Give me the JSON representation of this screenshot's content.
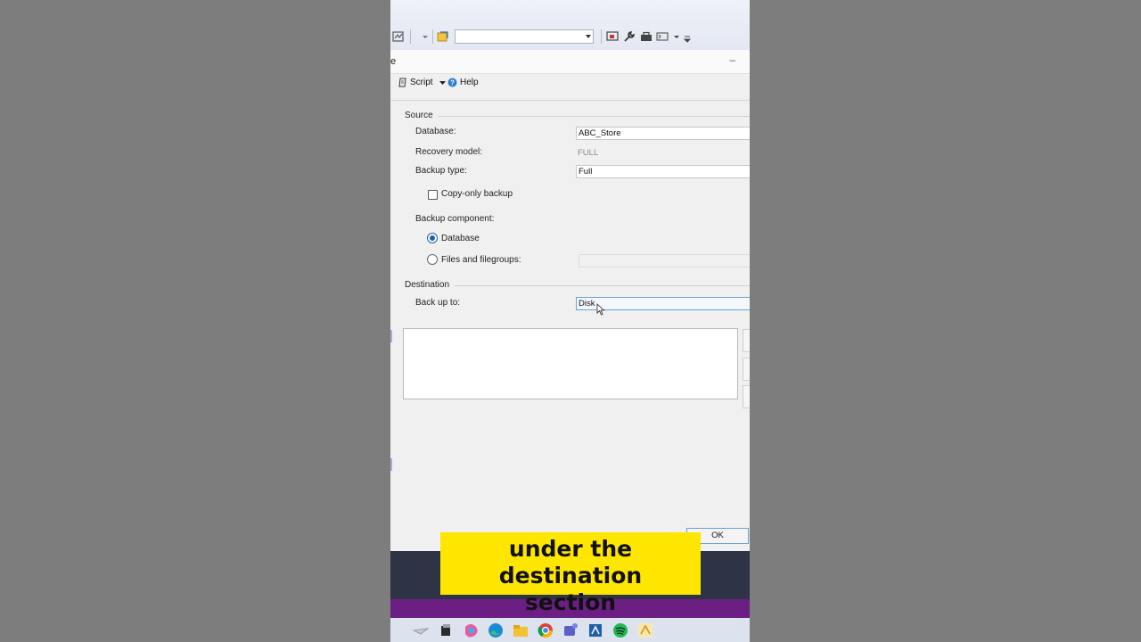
{
  "toolbar": {
    "combo_value": ""
  },
  "dialog": {
    "title_fragment": "e",
    "minimize_glyph": "–",
    "commands": {
      "script_label": "Script",
      "help_label": "Help"
    },
    "source": {
      "section_label": "Source",
      "database_label": "Database:",
      "database_value": "ABC_Store",
      "recovery_label": "Recovery model:",
      "recovery_value": "FULL",
      "backup_type_label": "Backup type:",
      "backup_type_value": "Full",
      "copy_only_label": "Copy-only backup",
      "copy_only_checked": false,
      "component_label": "Backup component:",
      "component_database_label": "Database",
      "component_files_label": "Files and filegroups:",
      "selected_component": "Database"
    },
    "destination": {
      "section_label": "Destination",
      "backup_to_label": "Back up to:",
      "backup_to_value": "Disk"
    },
    "ok_label": "OK"
  },
  "caption": {
    "line1": "under the destination",
    "line2": "section"
  },
  "colors": {
    "caption_bg": "#ffe600",
    "accent": "#1f5fa8",
    "focus_border": "#6aa0d8"
  }
}
